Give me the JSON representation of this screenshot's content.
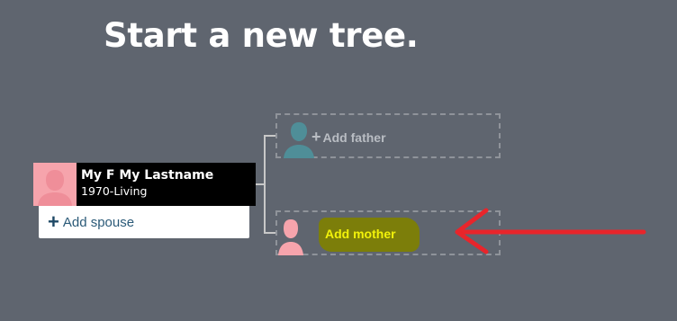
{
  "page": {
    "title": "Start a new tree."
  },
  "person": {
    "name": "My F My Lastname",
    "dates": "1970-Living",
    "photo_color": "#f6a4ac"
  },
  "spouse": {
    "plus": "+",
    "label": "Add spouse"
  },
  "father": {
    "plus": "+",
    "label": "Add father",
    "icon_color": "#4f8e98"
  },
  "mother": {
    "label": "Add mother",
    "icon_color": "#f6a4ac",
    "highlight_color": "#7c7e0a",
    "label_color": "#f2f20a"
  },
  "annotation": {
    "arrow_color": "#e8252b",
    "icon": "arrow-left-icon"
  },
  "colors": {
    "background": "#5f656f",
    "connector": "#c8c8c8",
    "dashed_border": "#8f939a"
  }
}
